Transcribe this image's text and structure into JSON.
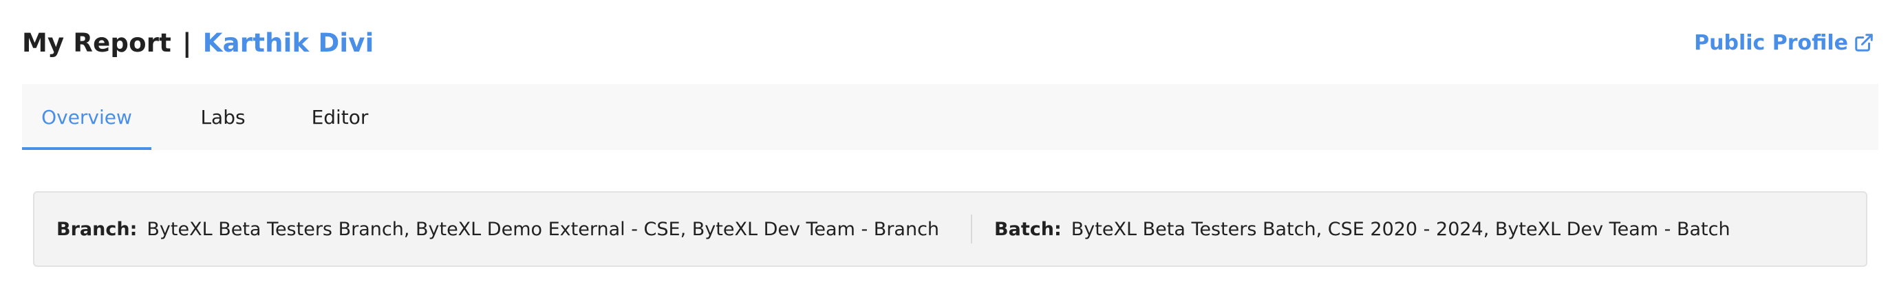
{
  "header": {
    "title": "My Report",
    "separator": "|",
    "user_name": "Karthik Divi",
    "public_profile_label": "Public Profile",
    "accent_color": "#4a8fe7"
  },
  "tabs": [
    {
      "label": "Overview",
      "active": true
    },
    {
      "label": "Labs",
      "active": false
    },
    {
      "label": "Editor",
      "active": false
    }
  ],
  "info": {
    "branch_label": "Branch:",
    "branch_value": "ByteXL Beta Testers Branch, ByteXL Demo External - CSE, ByteXL Dev Team - Branch",
    "batch_label": "Batch:",
    "batch_value": "ByteXL Beta Testers Batch, CSE 2020 - 2024, ByteXL Dev Team - Batch"
  },
  "icons": {
    "public_profile": "external-link-icon"
  }
}
